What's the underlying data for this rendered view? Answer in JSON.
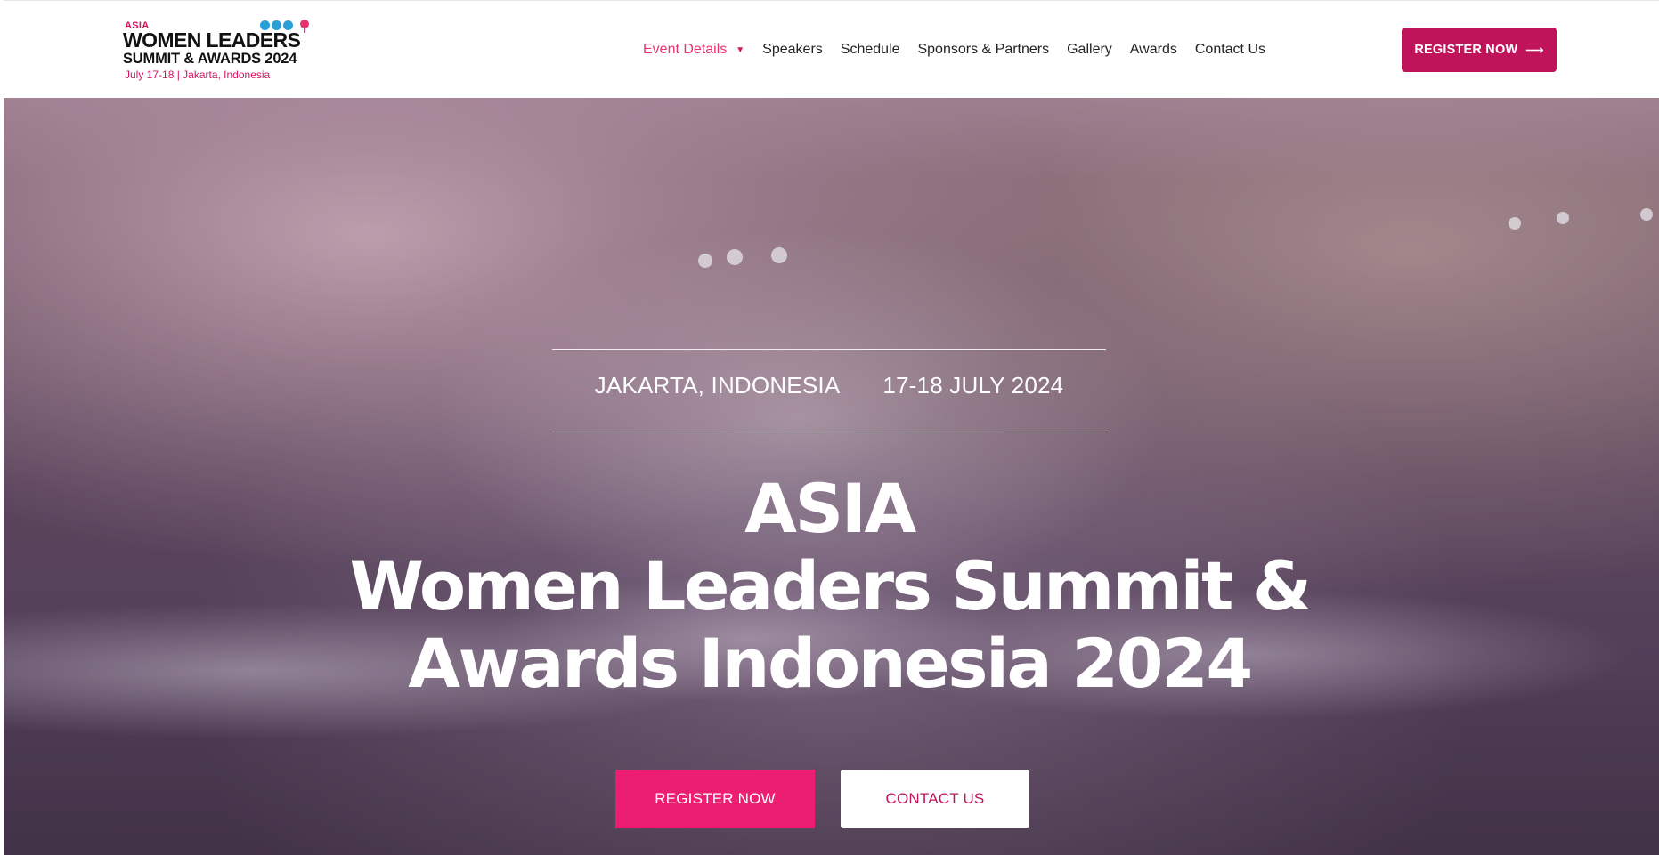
{
  "header": {
    "logo": {
      "asia": "ASIA",
      "line1": "WOMEN LEADERS",
      "line2": "SUMMIT & AWARDS 2024",
      "line3": "July 17-18 | Jakarta, Indonesia"
    },
    "nav": [
      {
        "label": "Event Details",
        "active": true,
        "icon": "caret-down-icon"
      },
      {
        "label": "Speakers"
      },
      {
        "label": "Schedule"
      },
      {
        "label": "Sponsors & Partners"
      },
      {
        "label": "Gallery"
      },
      {
        "label": "Awards"
      },
      {
        "label": "Contact Us"
      }
    ],
    "register_button": {
      "label": "REGISTER NOW",
      "icon": "arrow-right-icon"
    }
  },
  "hero": {
    "location": "JAKARTA, INDONESIA",
    "dates": "17-18 JULY 2024",
    "title_lines": [
      "ASIA",
      "Women Leaders Summit &",
      "Awards Indonesia 2024"
    ],
    "primary_button": "REGISTER NOW",
    "secondary_button": "CONTACT US"
  },
  "colors": {
    "accent": "#ec1e71",
    "brand": "#c0145a",
    "active_nav": "#e8336f",
    "text": "#222222"
  }
}
